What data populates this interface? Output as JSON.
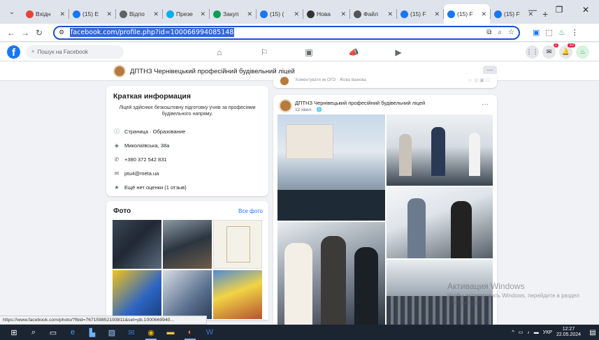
{
  "browser": {
    "tabs": [
      {
        "title": "Вхідн",
        "icon": "gmail-icon",
        "color": "#ea4335"
      },
      {
        "title": "(15) Е",
        "icon": "facebook-icon",
        "color": "#1877f2"
      },
      {
        "title": "Відпо",
        "icon": "globe-icon",
        "color": "#5f6368"
      },
      {
        "title": "Презе",
        "icon": "skype-icon",
        "color": "#00aff0"
      },
      {
        "title": "Закуп",
        "icon": "drive-icon",
        "color": "#0f9d58"
      },
      {
        "title": "(15) (",
        "icon": "facebook-icon",
        "color": "#1877f2"
      },
      {
        "title": "Нова",
        "icon": "chatgpt-icon",
        "color": "#333333"
      },
      {
        "title": "Файл",
        "icon": "file-icon",
        "color": "#555555"
      },
      {
        "title": "(15) F",
        "icon": "facebook-icon",
        "color": "#1877f2"
      },
      {
        "title": "(15) F",
        "icon": "facebook-icon",
        "color": "#1877f2",
        "active": true
      },
      {
        "title": "(15) F",
        "icon": "facebook-icon",
        "color": "#1877f2"
      }
    ],
    "url": "facebook.com/profile.php?id=100066994085148",
    "status_link": "https://www.facebook.com/photo/?fbid=767159852193811&set=pb.1000669940..."
  },
  "facebook": {
    "search_placeholder": "Пошук на Facebook",
    "notification_badge": "2",
    "messenger_badge": "10",
    "page_name": "ДПТНЗ Чернівецький професійний будівельний ліцей",
    "accent": "#1877f2"
  },
  "intro": {
    "title": "Краткая информация",
    "description": "Ліцей здійснює безкоштовну підготовку учнів за професіями будівельного напряму.",
    "rows": [
      {
        "icon": "info-icon",
        "text": "Страница · Образование"
      },
      {
        "icon": "location-icon",
        "text": "Миколаївська, 38а"
      },
      {
        "icon": "phone-icon",
        "text": "+380 372 542 831"
      },
      {
        "icon": "email-icon",
        "text": "ptu4@meta.ua"
      },
      {
        "icon": "star-icon",
        "text": "Ещё нет оценки (1 отзыв)"
      }
    ]
  },
  "photos": {
    "title": "Фото",
    "see_all": "Все фото"
  },
  "post_prev": {
    "text": "Коментувати як ОГО · Жова Іванова"
  },
  "post": {
    "author": "ДПТНЗ Чернівецький професійний будівельний ліцей",
    "time": "12 хвил. · 🌐"
  },
  "watermark": {
    "title": "Активация Windows",
    "text": "Чтобы активировать Windows, перейдите в раздел \"Параметры\"."
  },
  "taskbar": {
    "lang": "УКР",
    "time": "12:27",
    "date": "22.05.2024"
  }
}
